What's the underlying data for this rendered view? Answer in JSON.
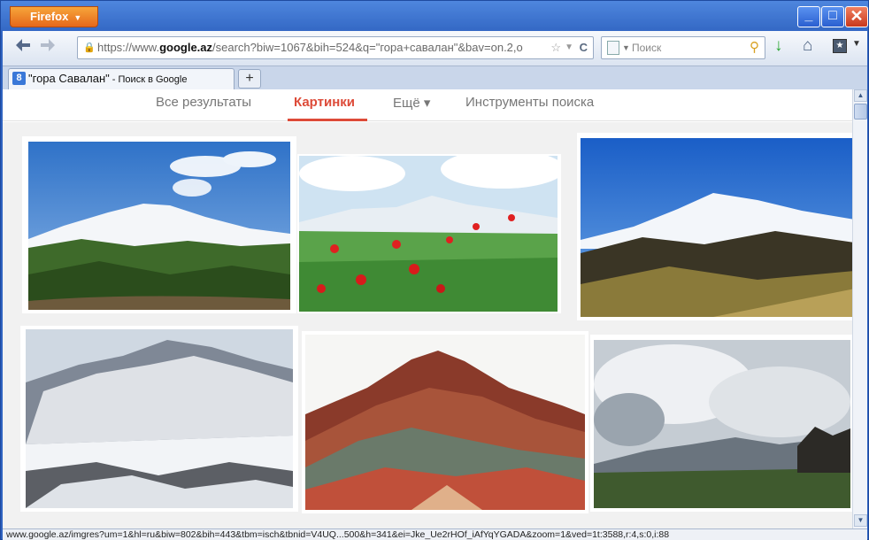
{
  "browser": {
    "menu_label": "Firefox",
    "menu_arrow": "▼",
    "min_glyph": "_",
    "max_glyph": "□",
    "close_glyph": "✕"
  },
  "nav": {
    "back_glyph": "◆",
    "forward_glyph": "➔",
    "url_prefix": "https://www.",
    "url_domain": "google.az",
    "url_rest": "/search?biw=1067&bih=524&q=\"гора+савалан\"&bav=on.2,o",
    "search_placeholder": "Поиск",
    "colors": {
      "download_arrow": "#2da834",
      "accent": "#dd4b39"
    }
  },
  "tab": {
    "title": "\"гора Савалан\"",
    "suffix": " - Поиск в Google",
    "favicon_letter": "8",
    "new_tab_label": "+"
  },
  "google_nav": {
    "all": "Все результаты",
    "images": "Картинки",
    "more": "Ещё ▾",
    "tools": "Инструменты поиска"
  },
  "images": [
    {
      "name": "snowy-peak-with-valley-road"
    },
    {
      "name": "mountain-with-red-poppies"
    },
    {
      "name": "snowy-mountain-over-brown-hills"
    },
    {
      "name": "snow-covered-mountain-winter"
    },
    {
      "name": "red-striped-hills"
    },
    {
      "name": "mountain-under-clouds"
    }
  ],
  "status_text": "www.google.az/imgres?um=1&hl=ru&biw=802&bih=443&tbm=isch&tbnid=V4UQ...500&h=341&ei=Jke_Ue2rHOf_iAfYqYGADA&zoom=1&ved=1t:3588,r:4,s:0,i:88"
}
